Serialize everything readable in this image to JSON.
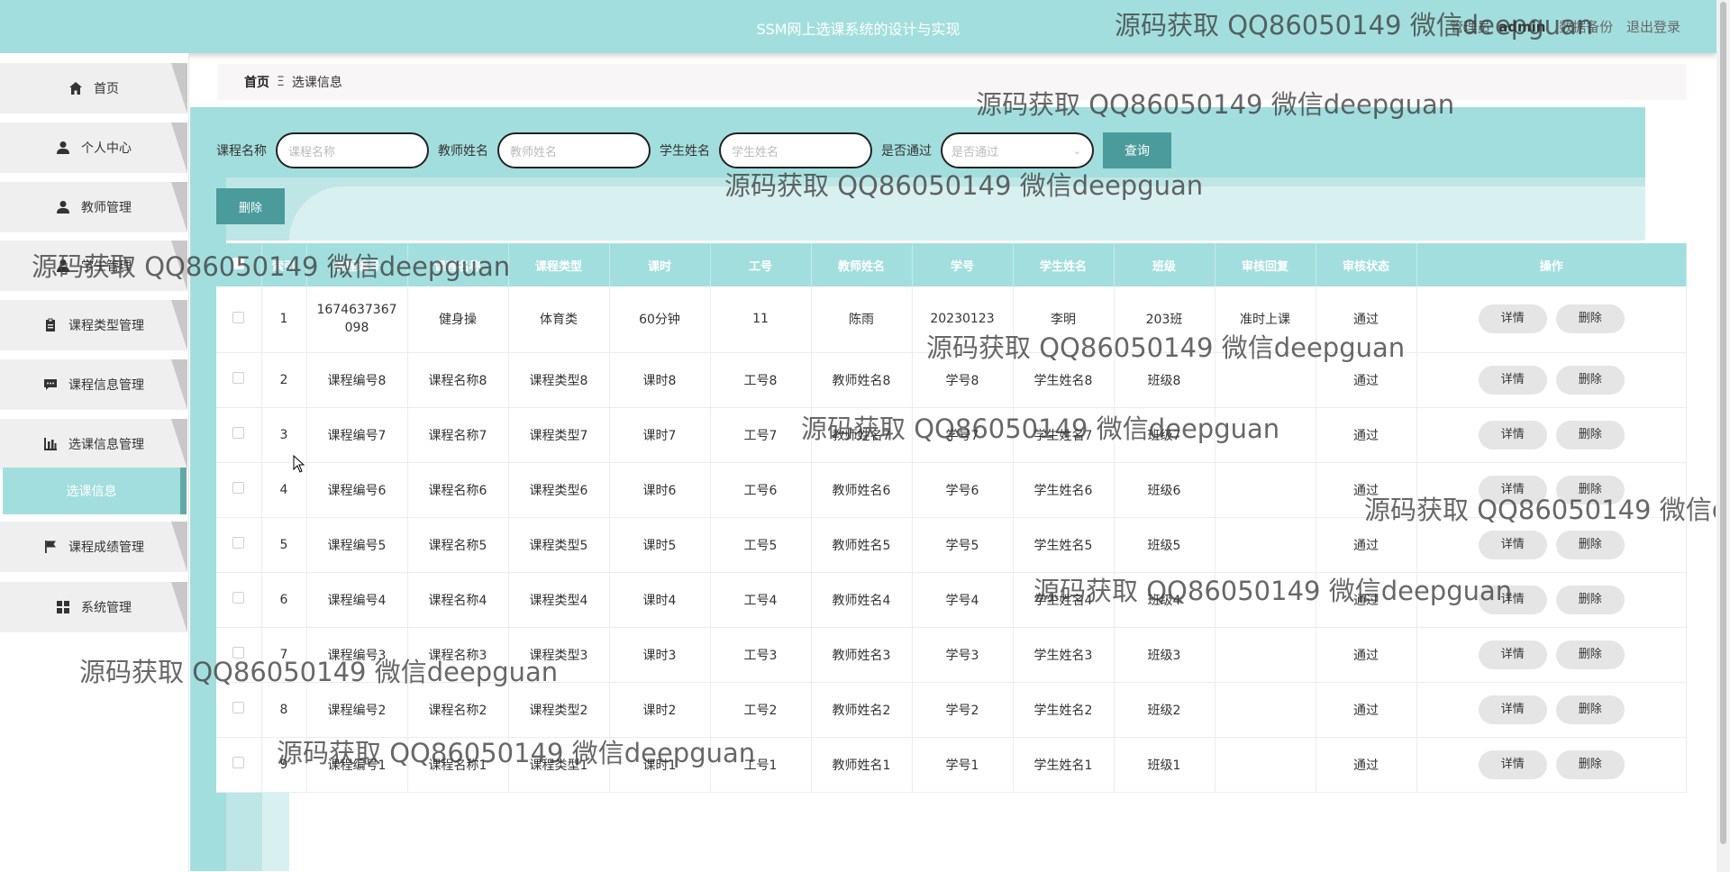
{
  "header": {
    "title": "SSM网上选课系统的设计与实现",
    "role": "管理员",
    "user": "admin",
    "backup": "数据备份",
    "logout": "退出登录"
  },
  "sidebar": {
    "items": [
      {
        "label": "首页",
        "icon": "home-icon"
      },
      {
        "label": "个人中心",
        "icon": "user-icon"
      },
      {
        "label": "教师管理",
        "icon": "user-icon"
      },
      {
        "label": "学生管理",
        "icon": "user-icon"
      },
      {
        "label": "课程类型管理",
        "icon": "clipboard-icon"
      },
      {
        "label": "课程信息管理",
        "icon": "chat-icon"
      },
      {
        "label": "选课信息管理",
        "icon": "chart-icon"
      },
      {
        "label": "课程成绩管理",
        "icon": "flag-icon"
      },
      {
        "label": "系统管理",
        "icon": "grid-icon"
      }
    ],
    "active_sub": "选课信息"
  },
  "breadcrumb": {
    "home": "首页",
    "sep": "Ξ",
    "current": "选课信息"
  },
  "search": {
    "course_name_label": "课程名称",
    "course_name_placeholder": "课程名称",
    "teacher_name_label": "教师姓名",
    "teacher_name_placeholder": "教师姓名",
    "student_name_label": "学生姓名",
    "student_name_placeholder": "学生姓名",
    "passed_label": "是否通过",
    "passed_placeholder": "是否通过",
    "query_button": "查询"
  },
  "actions": {
    "delete_button": "删除"
  },
  "table": {
    "columns": [
      "",
      "索引",
      "课程编号",
      "课程名称",
      "课程类型",
      "课时",
      "工号",
      "教师姓名",
      "学号",
      "学生姓名",
      "班级",
      "审核回复",
      "审核状态",
      "操作"
    ],
    "detail_label": "详情",
    "delete_label": "删除",
    "rows": [
      {
        "idx": "1",
        "code": "1674637367098",
        "name": "健身操",
        "type": "体育类",
        "hours": "60分钟",
        "job_no": "11",
        "teacher": "陈雨",
        "student_no": "20230123",
        "student": "李明",
        "class": "203班",
        "reply": "准时上课",
        "status": "通过"
      },
      {
        "idx": "2",
        "code": "课程编号8",
        "name": "课程名称8",
        "type": "课程类型8",
        "hours": "课时8",
        "job_no": "工号8",
        "teacher": "教师姓名8",
        "student_no": "学号8",
        "student": "学生姓名8",
        "class": "班级8",
        "reply": "",
        "status": "通过"
      },
      {
        "idx": "3",
        "code": "课程编号7",
        "name": "课程名称7",
        "type": "课程类型7",
        "hours": "课时7",
        "job_no": "工号7",
        "teacher": "教师姓名7",
        "student_no": "学号7",
        "student": "学生姓名7",
        "class": "班级7",
        "reply": "",
        "status": "通过"
      },
      {
        "idx": "4",
        "code": "课程编号6",
        "name": "课程名称6",
        "type": "课程类型6",
        "hours": "课时6",
        "job_no": "工号6",
        "teacher": "教师姓名6",
        "student_no": "学号6",
        "student": "学生姓名6",
        "class": "班级6",
        "reply": "",
        "status": "通过"
      },
      {
        "idx": "5",
        "code": "课程编号5",
        "name": "课程名称5",
        "type": "课程类型5",
        "hours": "课时5",
        "job_no": "工号5",
        "teacher": "教师姓名5",
        "student_no": "学号5",
        "student": "学生姓名5",
        "class": "班级5",
        "reply": "",
        "status": "通过"
      },
      {
        "idx": "6",
        "code": "课程编号4",
        "name": "课程名称4",
        "type": "课程类型4",
        "hours": "课时4",
        "job_no": "工号4",
        "teacher": "教师姓名4",
        "student_no": "学号4",
        "student": "学生姓名4",
        "class": "班级4",
        "reply": "",
        "status": "通过"
      },
      {
        "idx": "7",
        "code": "课程编号3",
        "name": "课程名称3",
        "type": "课程类型3",
        "hours": "课时3",
        "job_no": "工号3",
        "teacher": "教师姓名3",
        "student_no": "学号3",
        "student": "学生姓名3",
        "class": "班级3",
        "reply": "",
        "status": "通过"
      },
      {
        "idx": "8",
        "code": "课程编号2",
        "name": "课程名称2",
        "type": "课程类型2",
        "hours": "课时2",
        "job_no": "工号2",
        "teacher": "教师姓名2",
        "student_no": "学号2",
        "student": "学生姓名2",
        "class": "班级2",
        "reply": "",
        "status": "通过"
      },
      {
        "idx": "9",
        "code": "课程编号1",
        "name": "课程名称1",
        "type": "课程类型1",
        "hours": "课时1",
        "job_no": "工号1",
        "teacher": "教师姓名1",
        "student_no": "学号1",
        "student": "学生姓名1",
        "class": "班级1",
        "reply": "",
        "status": "通过"
      }
    ]
  },
  "watermark": "源码获取 QQ86050149 微信deepguan"
}
